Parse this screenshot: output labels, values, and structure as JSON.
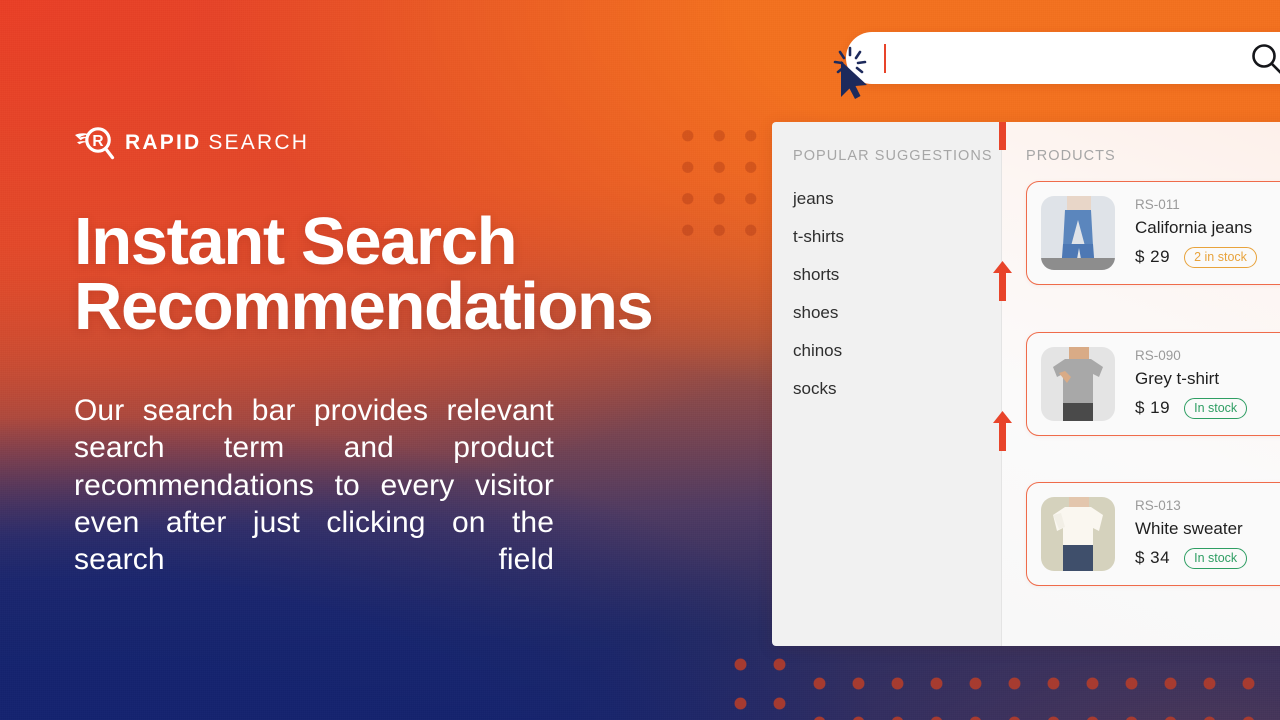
{
  "brand": {
    "name_bold": "RAPID",
    "name_light": "SEARCH",
    "logo_letter": "R",
    "accent": "#e8442a"
  },
  "hero": {
    "headline_line1": "Instant Search",
    "headline_line2": "Recommendations",
    "subcopy": "Our search bar provides relevant search term and product recommendations to every visitor even after just clicking on the search field"
  },
  "search": {
    "value": "",
    "placeholder": "",
    "icon": "magnifier-icon",
    "cursor": "click-cursor-icon"
  },
  "dropdown": {
    "suggestions": {
      "title": "POPULAR SUGGESTIONS",
      "items": [
        "jeans",
        "t-shirts",
        "shorts",
        "shoes",
        "chinos",
        "socks"
      ]
    },
    "products": {
      "title": "PRODUCTS",
      "items": [
        {
          "sku": "RS-011",
          "name": "California jeans",
          "price": "$ 29",
          "stock_label": "2 in stock",
          "stock_state": "low",
          "thumb": "jeans-photo"
        },
        {
          "sku": "RS-090",
          "name": "Grey t-shirt",
          "price": "$ 19",
          "stock_label": "In stock",
          "stock_state": "ok",
          "thumb": "tshirt-photo"
        },
        {
          "sku": "RS-013",
          "name": "White sweater",
          "price": "$ 34",
          "stock_label": "In stock",
          "stock_state": "ok",
          "thumb": "sweater-photo"
        }
      ]
    }
  },
  "colors": {
    "gradient_top_left": "#e8442a",
    "gradient_top_right": "#f4711f",
    "gradient_bottom_left": "#16266e",
    "card_border": "#ef6b4a",
    "badge_low": "#e8a33c",
    "badge_ok": "#2e9e63",
    "panel_bg": "#f1f1f1"
  }
}
